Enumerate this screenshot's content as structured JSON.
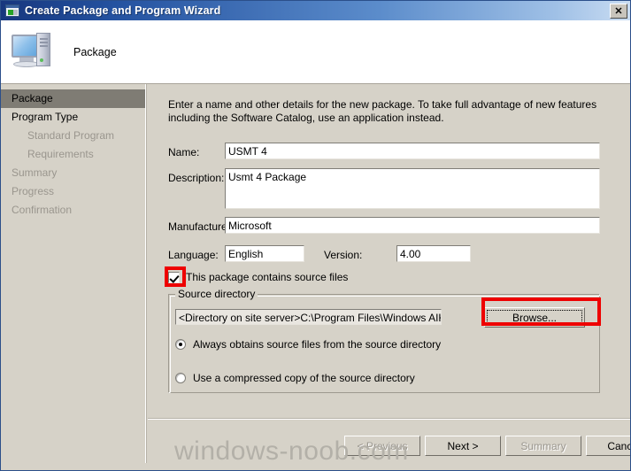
{
  "window": {
    "title": "Create Package and Program Wizard",
    "icon": "wizard-window-icon",
    "close_label": "✕"
  },
  "header": {
    "title": "Package",
    "icon": "computer-icon"
  },
  "sidebar": {
    "items": [
      {
        "label": "Package",
        "state": "selected",
        "indent": false
      },
      {
        "label": "Program Type",
        "state": "active",
        "indent": false
      },
      {
        "label": "Standard Program",
        "state": "pending",
        "indent": true
      },
      {
        "label": "Requirements",
        "state": "pending",
        "indent": true
      },
      {
        "label": "Summary",
        "state": "pending",
        "indent": false
      },
      {
        "label": "Progress",
        "state": "pending",
        "indent": false
      },
      {
        "label": "Confirmation",
        "state": "pending",
        "indent": false
      }
    ]
  },
  "main": {
    "intro": "Enter a name and other details for the new package. To take full advantage of new features including the Software Catalog, use an application instead.",
    "fields": {
      "name_label": "Name:",
      "name_value": "USMT 4",
      "description_label": "Description:",
      "description_value": "Usmt 4 Package",
      "manufacturer_label": "Manufacturer:",
      "manufacturer_value": "Microsoft",
      "language_label": "Language:",
      "language_value": "English",
      "version_label": "Version:",
      "version_value": "4.00"
    },
    "source_files_checkbox": {
      "label": "This package contains source files",
      "checked": true
    },
    "source_directory": {
      "group_title": "Source directory",
      "path_value": "<Directory on site server>C:\\Program Files\\Windows AIK\\Tools\\USM",
      "browse_label": "Browse...",
      "options": [
        {
          "label": "Always obtains source files from the source directory",
          "selected": true
        },
        {
          "label": "Use a compressed copy of the source directory",
          "selected": false
        }
      ]
    }
  },
  "footer": {
    "previous_label": "< Previous",
    "next_label": "Next >",
    "summary_label": "Summary",
    "cancel_label": "Cancel"
  },
  "watermark": {
    "text": "windows-noob.com"
  },
  "colors": {
    "dialog_face": "#d6d2c8",
    "title_bar_start": "#17377e",
    "title_bar_end": "#c9dcf2",
    "annotation": "#ee0000",
    "sidebar_selected": "#7f7c74",
    "disabled_text": "#9a968e"
  }
}
